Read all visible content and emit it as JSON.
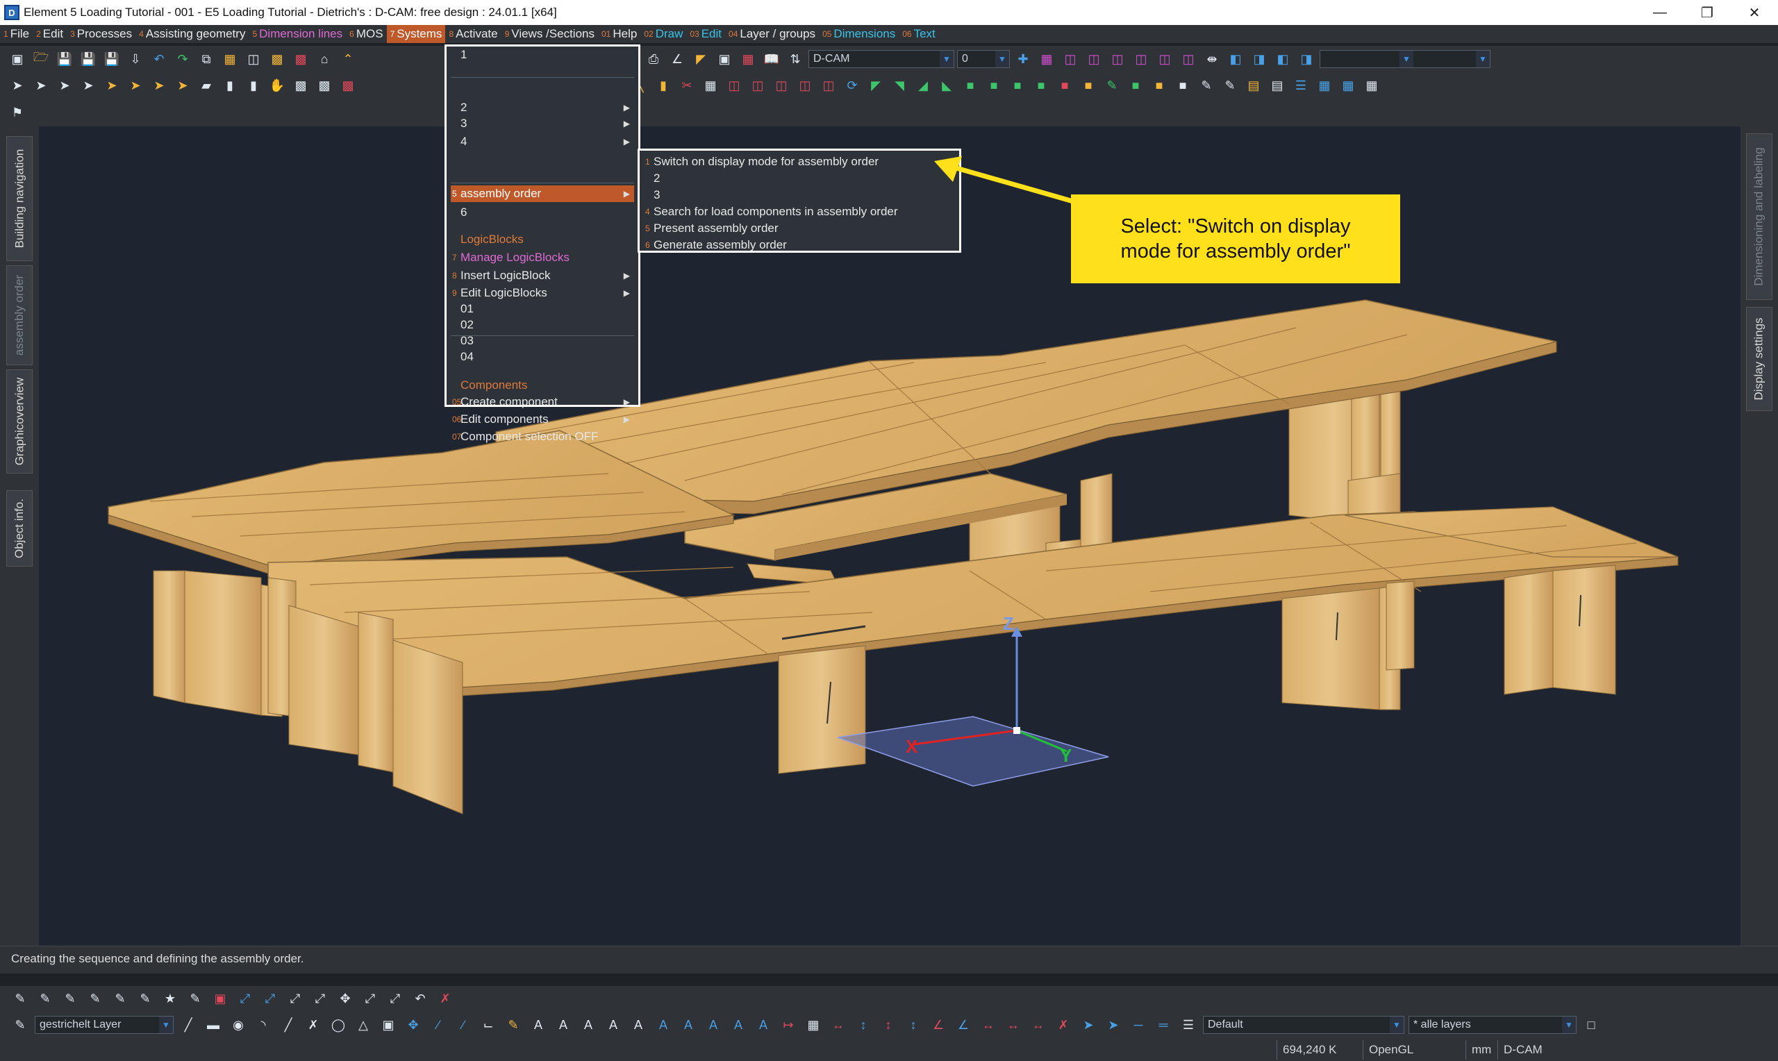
{
  "window": {
    "app_icon": "D",
    "title": "Element 5 Loading Tutorial - 001 - E5 Loading Tutorial - Dietrich's : D-CAM: free design : 24.01.1 [x64]",
    "minimize_icon": "minimize-icon",
    "restore_icon": "restore-icon",
    "close_icon": "close-icon"
  },
  "menubar": [
    {
      "num": "1",
      "label": "File"
    },
    {
      "num": "2",
      "label": "Edit"
    },
    {
      "num": "3",
      "label": "Processes"
    },
    {
      "num": "4",
      "label": "Assisting geometry"
    },
    {
      "num": "5",
      "label": "Dimension lines",
      "color": "pink"
    },
    {
      "num": "6",
      "label": "MOS"
    },
    {
      "num": "7",
      "label": "Systems",
      "active": true
    },
    {
      "num": "8",
      "label": "Activate"
    },
    {
      "num": "9",
      "label": "Views /Sections"
    },
    {
      "num": "01",
      "label": "Help"
    },
    {
      "num": "02",
      "label": "Draw",
      "color": "cyan"
    },
    {
      "num": "03",
      "label": "Edit",
      "color": "cyan"
    },
    {
      "num": "04",
      "label": "Layer / groups"
    },
    {
      "num": "05",
      "label": "Dimensions",
      "color": "cyan"
    },
    {
      "num": "06",
      "label": "Text",
      "color": "cyan"
    }
  ],
  "toolbar": {
    "cam_combo": "D-CAM",
    "number_combo": "0"
  },
  "systems_menu": {
    "items": [
      {
        "num": "",
        "label": "1",
        "submenu": false
      },
      {
        "num": "",
        "label": "2",
        "submenu": true
      },
      {
        "num": "",
        "label": "3",
        "submenu": true
      },
      {
        "num": "",
        "label": "4",
        "submenu": true
      },
      {
        "num": "5",
        "label": "assembly order",
        "submenu": true,
        "selected": true
      },
      {
        "num": "",
        "label": "6",
        "submenu": false
      },
      {
        "num": "",
        "label": "LogicBlocks",
        "header": true
      },
      {
        "num": "7",
        "label": "Manage LogicBlocks",
        "color": "pink"
      },
      {
        "num": "8",
        "label": "Insert LogicBlock",
        "submenu": true
      },
      {
        "num": "9",
        "label": "Edit LogicBlocks",
        "submenu": true
      },
      {
        "num": "",
        "label": "01"
      },
      {
        "num": "",
        "label": "02"
      },
      {
        "num": "",
        "label": "03"
      },
      {
        "num": "",
        "label": "04"
      },
      {
        "num": "",
        "label": "Components",
        "header": true
      },
      {
        "num": "05",
        "label": "Create component",
        "submenu": true
      },
      {
        "num": "06",
        "label": "Edit components",
        "submenu": true
      },
      {
        "num": "07",
        "label": "Component selection OFF"
      }
    ]
  },
  "assembly_submenu": {
    "items": [
      {
        "num": "1",
        "label": "Switch on display mode for assembly order"
      },
      {
        "num": "",
        "label": "2"
      },
      {
        "num": "",
        "label": "3"
      },
      {
        "num": "4",
        "label": "Search for load components in assembly order"
      },
      {
        "num": "5",
        "label": "Present assembly order"
      },
      {
        "num": "6",
        "label": "Generate assembly order"
      }
    ]
  },
  "callout": {
    "line1": "Select: \"Switch on display",
    "line2": "mode for assembly order\""
  },
  "left_tabs": [
    "Building navigation",
    "assembly order",
    "Graphicoverview",
    "Object info."
  ],
  "right_tabs": [
    "Dimensioning and labeling",
    "Display settings"
  ],
  "axes": {
    "x": "X",
    "y": "Y",
    "z": "Z"
  },
  "status_text": "Creating the sequence and defining the assembly order.",
  "bottom": {
    "layer_combo": "gestrichelt Layer",
    "style_combo": "Default",
    "layers_combo": "* alle layers"
  },
  "infobar": {
    "memory": "694,240 K",
    "renderer": "OpenGL",
    "unit": "mm",
    "module": "D-CAM"
  },
  "colors": {
    "accent": "#c0592a",
    "callout": "#ffe01a",
    "wood": "#d8ac68",
    "viewport": "#1e2530"
  }
}
